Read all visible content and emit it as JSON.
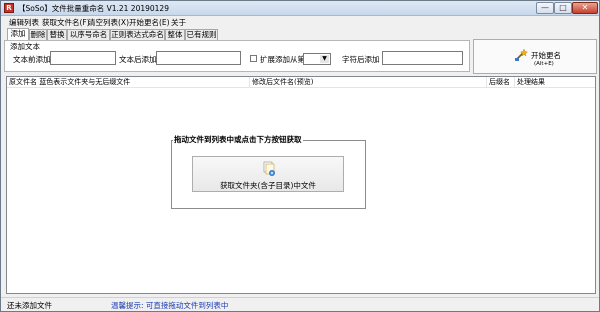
{
  "window": {
    "title": "【SoSo】文件批量重命名   V1.21 20190129",
    "app_icon_glyph": "R",
    "minimize_glyph": "—",
    "maximize_glyph": "□",
    "close_glyph": "✕"
  },
  "menu": [
    "编辑列表",
    "获取文件名(F)",
    "清空列表(X)",
    "开始更名(E)",
    "关于"
  ],
  "tabs": [
    {
      "label": "添加",
      "active": true
    },
    {
      "label": "删除",
      "active": false
    },
    {
      "label": "替换",
      "active": false
    },
    {
      "label": "以序号命名",
      "active": false
    },
    {
      "label": "正则表达式命名",
      "active": false
    },
    {
      "label": "整体",
      "active": false
    },
    {
      "label": "已有规则",
      "active": false
    }
  ],
  "options": {
    "group_label": "添加文本",
    "prefix_label": "文本前添加",
    "prefix_value": "",
    "suffix_label": "文本后添加",
    "suffix_value": "",
    "ext_checkbox_label": "扩展添加从第",
    "ext_checkbox_checked": false,
    "ext_position_value": "",
    "char_after_label": "字符后添加",
    "char_after_value": ""
  },
  "start_button": {
    "label": "开始更名",
    "shortcut": "(Alt+E)",
    "icon": "rename-wand-icon"
  },
  "list": {
    "columns": [
      "原文件名  蓝色表示文件夹与无后缀文件",
      "修改后文件名(预览)",
      "后缀名",
      "处理结果"
    ],
    "rows": []
  },
  "drop_hint": {
    "title": "拖动文件到列表中或点击下方按钮获取",
    "button_label": "获取文件夹(含子目录)中文件",
    "button_icon": "folder-files-icon"
  },
  "status": {
    "left": "还未添加文件",
    "tip": "温馨提示: 可直接拖动文件到列表中"
  },
  "colors": {
    "tip_text": "#1a3cb5",
    "app_icon": "#c83224"
  }
}
